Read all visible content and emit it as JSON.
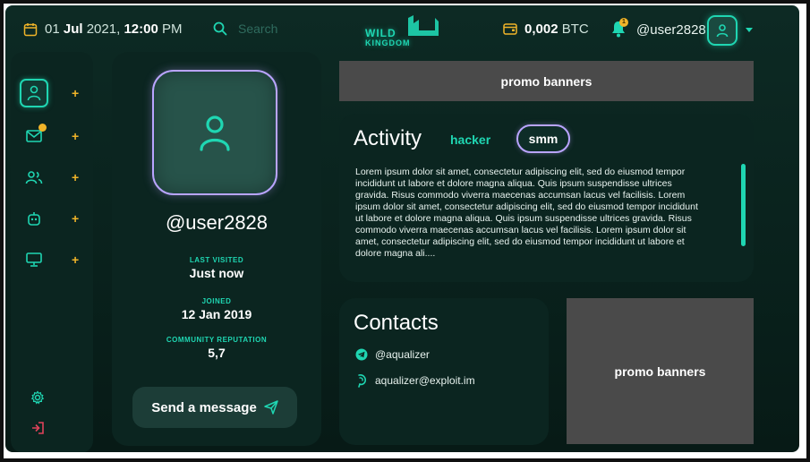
{
  "header": {
    "date_day": "01",
    "date_month": "Jul",
    "date_year": "2021,",
    "time": "12:00",
    "ampm": "PM",
    "search_placeholder": "Search",
    "logo_top": "WILD",
    "logo_bottom": "KINGDOM",
    "balance_amount": "0,002",
    "balance_currency": "BTC",
    "notification_count": "1",
    "username": "@user2828"
  },
  "sidebar": {
    "items": [
      {
        "icon": "user-icon",
        "active": true
      },
      {
        "icon": "mail-icon",
        "badge": true
      },
      {
        "icon": "users-icon"
      },
      {
        "icon": "robot-icon"
      },
      {
        "icon": "monitor-icon"
      }
    ],
    "plus_symbol": "+",
    "bottom": [
      {
        "icon": "gear-icon"
      },
      {
        "icon": "logout-icon"
      }
    ]
  },
  "profile": {
    "username": "@user2828",
    "last_visited_label": "LAST VISITED",
    "last_visited_value": "Just now",
    "joined_label": "JOINED",
    "joined_value": "12 Jan 2019",
    "reputation_label": "COMMUNITY REPUTATION",
    "reputation_value": "5,7",
    "send_button": "Send a message"
  },
  "promo": {
    "top_label": "promo banners",
    "side_label": "promo banners"
  },
  "activity": {
    "title": "Activity",
    "tags": [
      "hacker",
      "smm"
    ],
    "text": "Lorem ipsum dolor sit amet, consectetur adipiscing elit, sed do eiusmod tempor incididunt ut labore et dolore magna aliqua. Quis ipsum suspendisse ultrices gravida. Risus commodo viverra maecenas accumsan lacus vel facilisis. Lorem ipsum dolor sit amet, consectetur adipiscing elit, sed do eiusmod tempor incididunt ut labore et dolore magna aliqua. Quis ipsum suspendisse ultrices gravida. Risus commodo viverra maecenas accumsan lacus vel facilisis. Lorem ipsum dolor sit amet, consectetur adipiscing elit, sed do eiusmod tempor incididunt ut labore et dolore magna ali...."
  },
  "contacts": {
    "title": "Contacts",
    "telegram": "@aqualizer",
    "jabber": "aqualizer@exploit.im"
  },
  "colors": {
    "accent": "#1fd6b2",
    "highlight": "#b9a4ff",
    "badge": "#f0b429",
    "logout": "#e0435a",
    "panel": "#0b2520",
    "promo": "#4a4a4a"
  }
}
